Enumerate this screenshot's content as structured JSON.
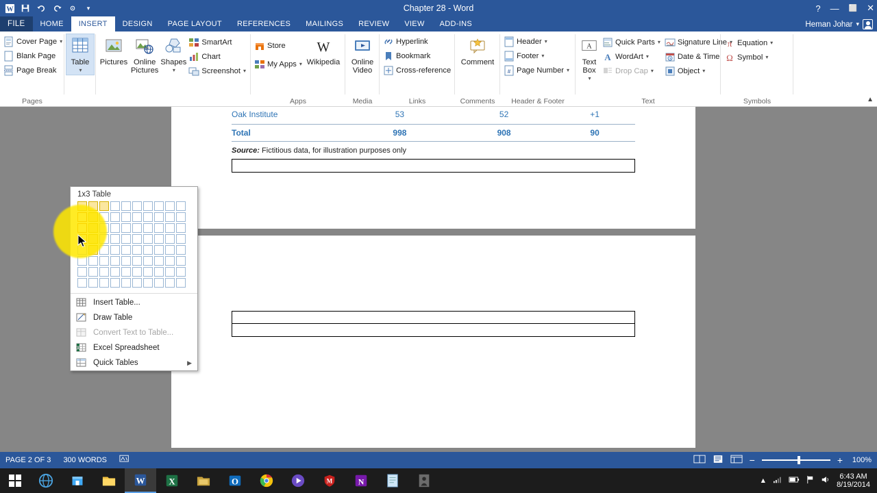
{
  "titlebar": {
    "title": "Chapter 28 - Word",
    "qat": [
      "word-icon",
      "save-icon",
      "undo-icon",
      "redo-icon",
      "touch-mode-icon",
      "customize-qat-icon"
    ],
    "help": "?",
    "ribbon_display": "❐",
    "minimize": "—",
    "maximize": "⬜",
    "close": "✕"
  },
  "tabs": [
    {
      "label": "FILE",
      "active": false
    },
    {
      "label": "HOME",
      "active": false
    },
    {
      "label": "INSERT",
      "active": true
    },
    {
      "label": "DESIGN",
      "active": false
    },
    {
      "label": "PAGE LAYOUT",
      "active": false
    },
    {
      "label": "REFERENCES",
      "active": false
    },
    {
      "label": "MAILINGS",
      "active": false
    },
    {
      "label": "REVIEW",
      "active": false
    },
    {
      "label": "VIEW",
      "active": false
    },
    {
      "label": "ADD-INS",
      "active": false
    }
  ],
  "user": {
    "name": "Heman Johar",
    "dropdown": "▾"
  },
  "ribbon": {
    "groups": [
      {
        "name": "Pages",
        "label": "Pages",
        "buttons": [
          {
            "label": "Cover Page",
            "dropdown": true
          },
          {
            "label": "Blank Page",
            "dropdown": false
          },
          {
            "label": "Page Break",
            "dropdown": false
          }
        ]
      },
      {
        "name": "Tables",
        "label": "",
        "buttons": [
          {
            "label": "Table",
            "dropdown": true,
            "active": true
          }
        ]
      },
      {
        "name": "Illustrations",
        "label": "",
        "buttons": [
          {
            "label": "Pictures"
          },
          {
            "label": "Online Pictures"
          },
          {
            "label": "Shapes",
            "dropdown": true
          },
          {
            "label": "SmartArt"
          },
          {
            "label": "Chart"
          },
          {
            "label": "Screenshot",
            "dropdown": true
          }
        ]
      },
      {
        "name": "Apps",
        "label": "Apps",
        "buttons": [
          {
            "label": "Store"
          },
          {
            "label": "My Apps",
            "dropdown": true
          },
          {
            "label": "Wikipedia"
          }
        ]
      },
      {
        "name": "Media",
        "label": "Media",
        "buttons": [
          {
            "label": "Online Video"
          }
        ]
      },
      {
        "name": "Links",
        "label": "Links",
        "buttons": [
          {
            "label": "Hyperlink"
          },
          {
            "label": "Bookmark"
          },
          {
            "label": "Cross-reference"
          }
        ]
      },
      {
        "name": "Comments",
        "label": "Comments",
        "buttons": [
          {
            "label": "Comment"
          }
        ]
      },
      {
        "name": "Header & Footer",
        "label": "Header & Footer",
        "buttons": [
          {
            "label": "Header",
            "dropdown": true
          },
          {
            "label": "Footer",
            "dropdown": true
          },
          {
            "label": "Page Number",
            "dropdown": true
          }
        ]
      },
      {
        "name": "Text",
        "label": "Text",
        "buttons": [
          {
            "label": "Text Box",
            "dropdown": true
          },
          {
            "label": "Quick Parts",
            "dropdown": true
          },
          {
            "label": "WordArt",
            "dropdown": true
          },
          {
            "label": "Drop Cap",
            "dropdown": true,
            "disabled": true
          },
          {
            "label": "Signature Line",
            "dropdown": true
          },
          {
            "label": "Date & Time"
          },
          {
            "label": "Object",
            "dropdown": true
          }
        ]
      },
      {
        "name": "Symbols",
        "label": "Symbols",
        "buttons": [
          {
            "label": "Equation",
            "dropdown": true
          },
          {
            "label": "Symbol",
            "dropdown": true
          }
        ]
      }
    ]
  },
  "table_menu": {
    "title": "1x3 Table",
    "grid": {
      "cols": 10,
      "rows": 8,
      "selected_cols": 3,
      "selected_rows": 1,
      "hover_col": 1,
      "hover_row": 4
    },
    "items": [
      {
        "label": "Insert Table...",
        "icon": "insert-table-icon",
        "disabled": false
      },
      {
        "label": "Draw Table",
        "icon": "draw-table-icon",
        "disabled": false
      },
      {
        "label": "Convert Text to Table...",
        "icon": "convert-text-icon",
        "disabled": true
      },
      {
        "label": "Excel Spreadsheet",
        "icon": "excel-icon",
        "disabled": false
      },
      {
        "label": "Quick Tables",
        "icon": "quick-tables-icon",
        "disabled": false,
        "submenu": "▶"
      }
    ]
  },
  "document": {
    "rows": [
      {
        "c1": "Oak Institute",
        "c2": "53",
        "c3": "52",
        "c4": "+1",
        "bold": false
      },
      {
        "c1": "Total",
        "c2": "998",
        "c3": "908",
        "c4": "90",
        "bold": true
      }
    ],
    "source_label": "Source:",
    "source_text": " Fictitious data, for illustration purposes only"
  },
  "statusbar": {
    "page": "PAGE 2 OF 3",
    "words": "300 WORDS",
    "proofing": "proofing-icon",
    "views": [
      "read-mode-icon",
      "print-layout-icon",
      "web-layout-icon"
    ],
    "zoom_out": "−",
    "zoom_in": "+",
    "zoom": "100%"
  },
  "taskbar": {
    "start": "start-icon",
    "items": [
      "edge-icon",
      "store-icon",
      "explorer-icon",
      "word-icon",
      "excel-icon",
      "folder-icon",
      "outlook-icon",
      "chrome-icon",
      "media-player-icon",
      "mcafee-icon",
      "onenote-icon",
      "notepad-icon",
      "app-icon"
    ],
    "tray": [
      "show-hidden-icon",
      "network-icon",
      "battery-icon",
      "flag-icon",
      "volume-icon"
    ],
    "time": "6:43 AM",
    "date": "8/19/2014"
  }
}
